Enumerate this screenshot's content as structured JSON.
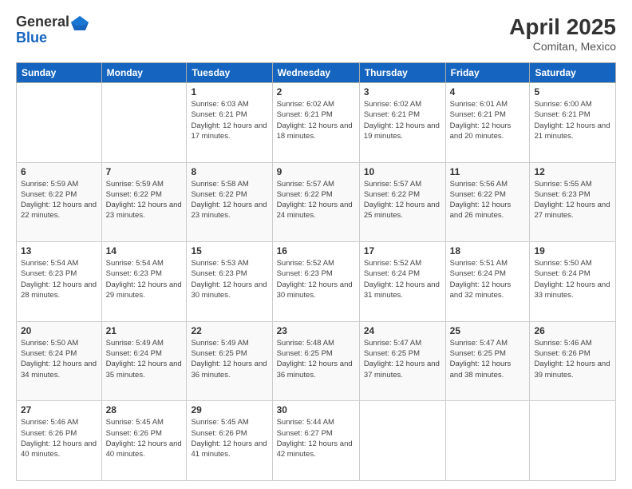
{
  "logo": {
    "general": "General",
    "blue": "Blue"
  },
  "title": "April 2025",
  "subtitle": "Comitan, Mexico",
  "days_of_week": [
    "Sunday",
    "Monday",
    "Tuesday",
    "Wednesday",
    "Thursday",
    "Friday",
    "Saturday"
  ],
  "weeks": [
    [
      {
        "day": "",
        "info": ""
      },
      {
        "day": "",
        "info": ""
      },
      {
        "day": "1",
        "info": "Sunrise: 6:03 AM\nSunset: 6:21 PM\nDaylight: 12 hours and 17 minutes."
      },
      {
        "day": "2",
        "info": "Sunrise: 6:02 AM\nSunset: 6:21 PM\nDaylight: 12 hours and 18 minutes."
      },
      {
        "day": "3",
        "info": "Sunrise: 6:02 AM\nSunset: 6:21 PM\nDaylight: 12 hours and 19 minutes."
      },
      {
        "day": "4",
        "info": "Sunrise: 6:01 AM\nSunset: 6:21 PM\nDaylight: 12 hours and 20 minutes."
      },
      {
        "day": "5",
        "info": "Sunrise: 6:00 AM\nSunset: 6:21 PM\nDaylight: 12 hours and 21 minutes."
      }
    ],
    [
      {
        "day": "6",
        "info": "Sunrise: 5:59 AM\nSunset: 6:22 PM\nDaylight: 12 hours and 22 minutes."
      },
      {
        "day": "7",
        "info": "Sunrise: 5:59 AM\nSunset: 6:22 PM\nDaylight: 12 hours and 23 minutes."
      },
      {
        "day": "8",
        "info": "Sunrise: 5:58 AM\nSunset: 6:22 PM\nDaylight: 12 hours and 23 minutes."
      },
      {
        "day": "9",
        "info": "Sunrise: 5:57 AM\nSunset: 6:22 PM\nDaylight: 12 hours and 24 minutes."
      },
      {
        "day": "10",
        "info": "Sunrise: 5:57 AM\nSunset: 6:22 PM\nDaylight: 12 hours and 25 minutes."
      },
      {
        "day": "11",
        "info": "Sunrise: 5:56 AM\nSunset: 6:22 PM\nDaylight: 12 hours and 26 minutes."
      },
      {
        "day": "12",
        "info": "Sunrise: 5:55 AM\nSunset: 6:23 PM\nDaylight: 12 hours and 27 minutes."
      }
    ],
    [
      {
        "day": "13",
        "info": "Sunrise: 5:54 AM\nSunset: 6:23 PM\nDaylight: 12 hours and 28 minutes."
      },
      {
        "day": "14",
        "info": "Sunrise: 5:54 AM\nSunset: 6:23 PM\nDaylight: 12 hours and 29 minutes."
      },
      {
        "day": "15",
        "info": "Sunrise: 5:53 AM\nSunset: 6:23 PM\nDaylight: 12 hours and 30 minutes."
      },
      {
        "day": "16",
        "info": "Sunrise: 5:52 AM\nSunset: 6:23 PM\nDaylight: 12 hours and 30 minutes."
      },
      {
        "day": "17",
        "info": "Sunrise: 5:52 AM\nSunset: 6:24 PM\nDaylight: 12 hours and 31 minutes."
      },
      {
        "day": "18",
        "info": "Sunrise: 5:51 AM\nSunset: 6:24 PM\nDaylight: 12 hours and 32 minutes."
      },
      {
        "day": "19",
        "info": "Sunrise: 5:50 AM\nSunset: 6:24 PM\nDaylight: 12 hours and 33 minutes."
      }
    ],
    [
      {
        "day": "20",
        "info": "Sunrise: 5:50 AM\nSunset: 6:24 PM\nDaylight: 12 hours and 34 minutes."
      },
      {
        "day": "21",
        "info": "Sunrise: 5:49 AM\nSunset: 6:24 PM\nDaylight: 12 hours and 35 minutes."
      },
      {
        "day": "22",
        "info": "Sunrise: 5:49 AM\nSunset: 6:25 PM\nDaylight: 12 hours and 36 minutes."
      },
      {
        "day": "23",
        "info": "Sunrise: 5:48 AM\nSunset: 6:25 PM\nDaylight: 12 hours and 36 minutes."
      },
      {
        "day": "24",
        "info": "Sunrise: 5:47 AM\nSunset: 6:25 PM\nDaylight: 12 hours and 37 minutes."
      },
      {
        "day": "25",
        "info": "Sunrise: 5:47 AM\nSunset: 6:25 PM\nDaylight: 12 hours and 38 minutes."
      },
      {
        "day": "26",
        "info": "Sunrise: 5:46 AM\nSunset: 6:26 PM\nDaylight: 12 hours and 39 minutes."
      }
    ],
    [
      {
        "day": "27",
        "info": "Sunrise: 5:46 AM\nSunset: 6:26 PM\nDaylight: 12 hours and 40 minutes."
      },
      {
        "day": "28",
        "info": "Sunrise: 5:45 AM\nSunset: 6:26 PM\nDaylight: 12 hours and 40 minutes."
      },
      {
        "day": "29",
        "info": "Sunrise: 5:45 AM\nSunset: 6:26 PM\nDaylight: 12 hours and 41 minutes."
      },
      {
        "day": "30",
        "info": "Sunrise: 5:44 AM\nSunset: 6:27 PM\nDaylight: 12 hours and 42 minutes."
      },
      {
        "day": "",
        "info": ""
      },
      {
        "day": "",
        "info": ""
      },
      {
        "day": "",
        "info": ""
      }
    ]
  ]
}
